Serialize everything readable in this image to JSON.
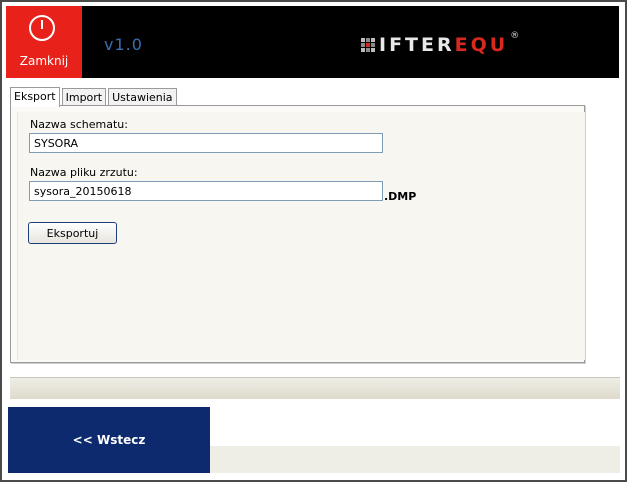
{
  "header": {
    "close_label": "Zamknij",
    "version": "v1.0",
    "logo_white": "IFTER",
    "logo_red": "EQU",
    "logo_reg": "®",
    "brand_colors": {
      "red": "#e8221b",
      "black": "#000000",
      "version_blue": "#3a6fb0"
    }
  },
  "tabs": [
    {
      "label": "Eksport",
      "active": true
    },
    {
      "label": "Import",
      "active": false
    },
    {
      "label": "Ustawienia",
      "active": false
    }
  ],
  "export_form": {
    "schema_label": "Nazwa schematu:",
    "schema_value": "SYSORA",
    "dump_label": "Nazwa pliku zrzutu:",
    "dump_value": "sysora_20150618",
    "dump_suffix": ".DMP",
    "export_button": "Eksportuj"
  },
  "footer": {
    "back_button": "<< Wstecz",
    "back_color": "#0d2a6e"
  }
}
